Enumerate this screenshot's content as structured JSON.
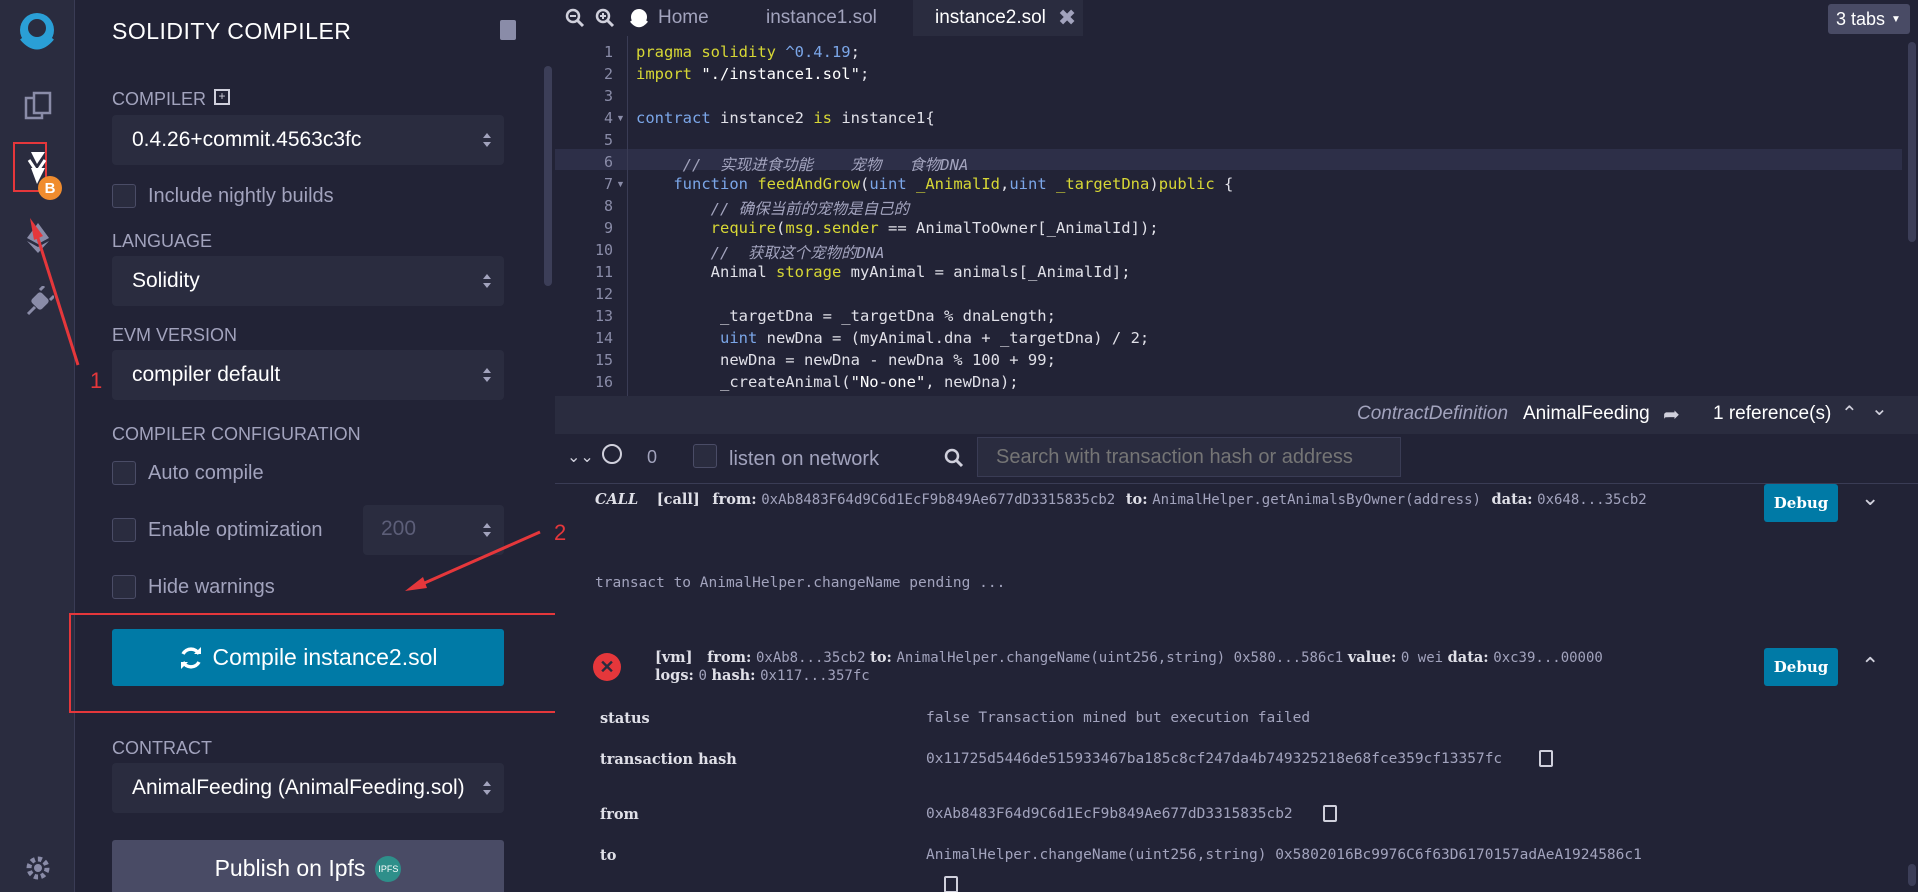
{
  "sidebar": {
    "title": "SOLIDITY COMPILER",
    "compiler_label": "COMPILER",
    "compiler_value": "0.4.26+commit.4563c3fc",
    "nightly_label": "Include nightly builds",
    "language_label": "LANGUAGE",
    "language_value": "Solidity",
    "evm_label": "EVM VERSION",
    "evm_value": "compiler default",
    "config_label": "COMPILER CONFIGURATION",
    "auto_compile_label": "Auto compile",
    "optimization_label": "Enable optimization",
    "optimization_runs": "200",
    "hide_warnings_label": "Hide warnings",
    "compile_button": "Compile instance2.sol",
    "contract_label": "CONTRACT",
    "contract_value": "AnimalFeeding (AnimalFeeding.sol)",
    "publish_button": "Publish on Ipfs",
    "ipfs_badge": "IPFS",
    "plugin_badge": "B"
  },
  "tabs": {
    "home": "Home",
    "tab1": "instance1.sol",
    "tab2": "instance2.sol",
    "count": "3 tabs"
  },
  "editor": {
    "line_numbers": [
      "1",
      "2",
      "3",
      "4",
      "5",
      "6",
      "7",
      "8",
      "9",
      "10",
      "11",
      "12",
      "13",
      "14",
      "15",
      "16"
    ],
    "reference_kind": "ContractDefinition",
    "reference_name": "AnimalFeeding",
    "reference_count": "1 reference(s)"
  },
  "terminal": {
    "pending_count": "0",
    "listen_label": "listen on network",
    "search_placeholder": "Search with transaction hash or address",
    "call_tag": "CALL",
    "call_line": "[call]",
    "call_from_label": "from:",
    "call_from": "0xAb8483F64d9C6d1EcF9b849Ae677dD3315835cb2",
    "call_to_label": "to:",
    "call_to": "AnimalHelper.getAnimalsByOwner(address)",
    "call_data_label": "data:",
    "call_data": "0x648...35cb2",
    "debug_label": "Debug",
    "pending_line": "transact to AnimalHelper.changeName pending ...",
    "vm_tag": "[vm]",
    "vm_from_label": "from:",
    "vm_from": "0xAb8...35cb2",
    "vm_to_label": "to:",
    "vm_to": "AnimalHelper.changeName(uint256,string) 0x580...586c1",
    "vm_value_label": "value:",
    "vm_value": "0 wei",
    "vm_data_label": "data:",
    "vm_data": "0xc39...00000",
    "vm_logs_label": "logs:",
    "vm_logs": "0",
    "vm_hash_label": "hash:",
    "vm_hash": "0x117...357fc",
    "rows": [
      {
        "key": "status",
        "value": "false Transaction mined but execution failed"
      },
      {
        "key": "transaction hash",
        "value": "0x11725d5446de515933467ba185c8cf247da4b749325218e68fce359cf13357fc"
      },
      {
        "key": "from",
        "value": "0xAb8483F64d9C6d1EcF9b849Ae677dD3315835cb2"
      },
      {
        "key": "to",
        "value": "AnimalHelper.changeName(uint256,string) 0x5802016Bc9976C6f63D6170157adAeA1924586c1"
      }
    ]
  },
  "annotations": {
    "one": "1",
    "two": "2"
  },
  "colors": {
    "accent": "#007aa6",
    "annotation": "#e5373b",
    "keyword": "#d7d735",
    "type": "#7ba6e8"
  }
}
